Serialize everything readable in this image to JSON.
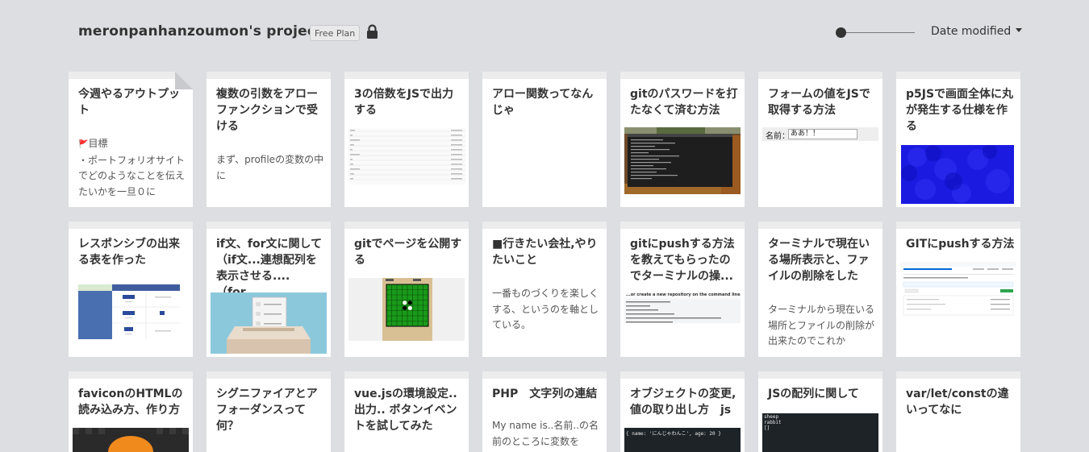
{
  "header": {
    "project_title": "meronpanhanzoumon's project",
    "plan_badge": "Free Plan",
    "sort_label": "Date modified"
  },
  "cards": [
    {
      "title": "今週やるアウトプット",
      "body_flag": "🚩",
      "body": "目標\n・ポートフォリオサイトでどのようなことを伝えたいかを一旦０に"
    },
    {
      "title": "複数の引数をアローファンクションで受ける",
      "body": "まず、profileの変数の中にname,prefecture,age"
    },
    {
      "title": "3の倍数をJSで出力する"
    },
    {
      "title": "アロー関数ってなんじゃ"
    },
    {
      "title": "gitのパスワードを打たなくて済む方法"
    },
    {
      "title": "フォームの値をJSで取得する方法",
      "thumb_label": "名前：",
      "thumb_value": "ああ！！"
    },
    {
      "title": "p5JSで画面全体に丸が発生する仕様を作る"
    },
    {
      "title": "レスポンシブの出来る表を作った"
    },
    {
      "title": "if文、for文に関して（if文...連想配列を表示させる....（for...",
      "title_display": "if文、for文に関して（if文...連想配列を表示させる....（for..."
    },
    {
      "title": "gitでページを公開する"
    },
    {
      "title": "■行きたい会社,やりたいこと",
      "body": "一番ものづくりを楽しくする、というのを軸としている。"
    },
    {
      "title": "gitにpushする方法を教えてもらったのでターミナルの操...",
      "thumb_label": "...or create a new repository on the command line"
    },
    {
      "title": "ターミナルで現在いる場所表示と、ファイルの削除をした",
      "body": "ターミナルから現在いる場所とファイルの削除が出来たのでこれか"
    },
    {
      "title": "GITにpushする方法"
    },
    {
      "title": "faviconのHTMLの読み込み方、作り方"
    },
    {
      "title": "シグニファイアとアフォーダンスって何？"
    },
    {
      "title": "vue.jsの環境設定..出力.. ボタンイベントを試してみた"
    },
    {
      "title": "PHP　文字列の連結",
      "body": "My name is..名前..の名前のところに変数を"
    },
    {
      "title": "オブジェクトの変更,値の取り出し方　js",
      "thumb_label": "{ name: 'にんじゃわんこ', age: 20 }"
    },
    {
      "title": "JSの配列に関して",
      "thumb_lines": [
        "sheep",
        "rabbit",
        "[]"
      ]
    },
    {
      "title": "var/let/constの違いってなに"
    }
  ],
  "colors": {
    "page_bg": "#dddee2",
    "card_bg": "#ffffff",
    "title_text": "#333333",
    "p5_blue": "#1a1ae0",
    "terminal_bg": "#1d2327",
    "othello_green": "#1a9a1a"
  },
  "icons": {
    "lock": "lock-icon",
    "caret": "caret-down-icon",
    "flag": "flag-icon",
    "fold": "page-fold-icon"
  }
}
